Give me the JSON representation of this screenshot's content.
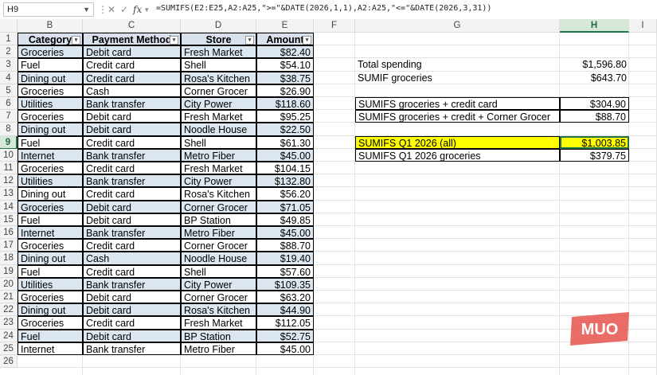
{
  "formula_bar": {
    "name_box": "H9",
    "formula": "=SUMIFS(E2:E25,A2:A25,\">=\"&DATE(2026,1,1),A2:A25,\"<=\"&DATE(2026,3,31))"
  },
  "columns": [
    "B",
    "C",
    "D",
    "E",
    "F",
    "G",
    "H",
    "I"
  ],
  "selected_column": "H",
  "selected_row": 9,
  "headers": [
    "Category",
    "Payment Method",
    "Store",
    "Amount"
  ],
  "rows": [
    [
      "Groceries",
      "Debit card",
      "Fresh Market",
      "$82.40"
    ],
    [
      "Fuel",
      "Credit card",
      "Shell",
      "$54.10"
    ],
    [
      "Dining out",
      "Credit card",
      "Rosa's Kitchen",
      "$38.75"
    ],
    [
      "Groceries",
      "Cash",
      "Corner Grocer",
      "$26.90"
    ],
    [
      "Utilities",
      "Bank transfer",
      "City Power",
      "$118.60"
    ],
    [
      "Groceries",
      "Debit card",
      "Fresh Market",
      "$95.25"
    ],
    [
      "Dining out",
      "Debit card",
      "Noodle House",
      "$22.50"
    ],
    [
      "Fuel",
      "Credit card",
      "Shell",
      "$61.30"
    ],
    [
      "Internet",
      "Bank transfer",
      "Metro Fiber",
      "$45.00"
    ],
    [
      "Groceries",
      "Credit card",
      "Fresh Market",
      "$104.15"
    ],
    [
      "Utilities",
      "Bank transfer",
      "City Power",
      "$132.80"
    ],
    [
      "Dining out",
      "Credit card",
      "Rosa's Kitchen",
      "$56.20"
    ],
    [
      "Groceries",
      "Debit card",
      "Corner Grocer",
      "$71.05"
    ],
    [
      "Fuel",
      "Debit card",
      "BP Station",
      "$49.85"
    ],
    [
      "Internet",
      "Bank transfer",
      "Metro Fiber",
      "$45.00"
    ],
    [
      "Groceries",
      "Credit card",
      "Corner Grocer",
      "$88.70"
    ],
    [
      "Dining out",
      "Cash",
      "Noodle House",
      "$19.40"
    ],
    [
      "Fuel",
      "Credit card",
      "Shell",
      "$57.60"
    ],
    [
      "Utilities",
      "Bank transfer",
      "City Power",
      "$109.35"
    ],
    [
      "Groceries",
      "Debit card",
      "Corner Grocer",
      "$63.20"
    ],
    [
      "Dining out",
      "Debit card",
      "Rosa's Kitchen",
      "$44.90"
    ],
    [
      "Groceries",
      "Credit card",
      "Fresh Market",
      "$112.05"
    ],
    [
      "Fuel",
      "Debit card",
      "BP Station",
      "$52.75"
    ],
    [
      "Internet",
      "Bank transfer",
      "Metro Fiber",
      "$45.00"
    ]
  ],
  "summary": [
    {
      "row": 3,
      "label": "Total spending",
      "value": "$1,596.80",
      "boxed": false,
      "highlight": false
    },
    {
      "row": 4,
      "label": "SUMIF groceries",
      "value": "$643.70",
      "boxed": false,
      "highlight": false
    },
    {
      "row": 6,
      "label": "SUMIFS groceries + credit card",
      "value": "$304.90",
      "boxed": true,
      "highlight": false
    },
    {
      "row": 7,
      "label": "SUMIFS groceries + credit + Corner Grocer",
      "value": "$88.70",
      "boxed": true,
      "highlight": false
    },
    {
      "row": 9,
      "label": "SUMIFS Q1 2026 (all)",
      "value": "$1,003.85",
      "boxed": true,
      "highlight": true
    },
    {
      "row": 10,
      "label": "SUMIFS Q1 2026 groceries",
      "value": "$379.75",
      "boxed": true,
      "highlight": false
    }
  ],
  "colors": {
    "header_blue": "#d9e1ec",
    "band_blue": "#dce6f0",
    "highlight": "#ffff00",
    "selection": "#217346",
    "logo": "#e5534b"
  },
  "watermark": "MUO"
}
